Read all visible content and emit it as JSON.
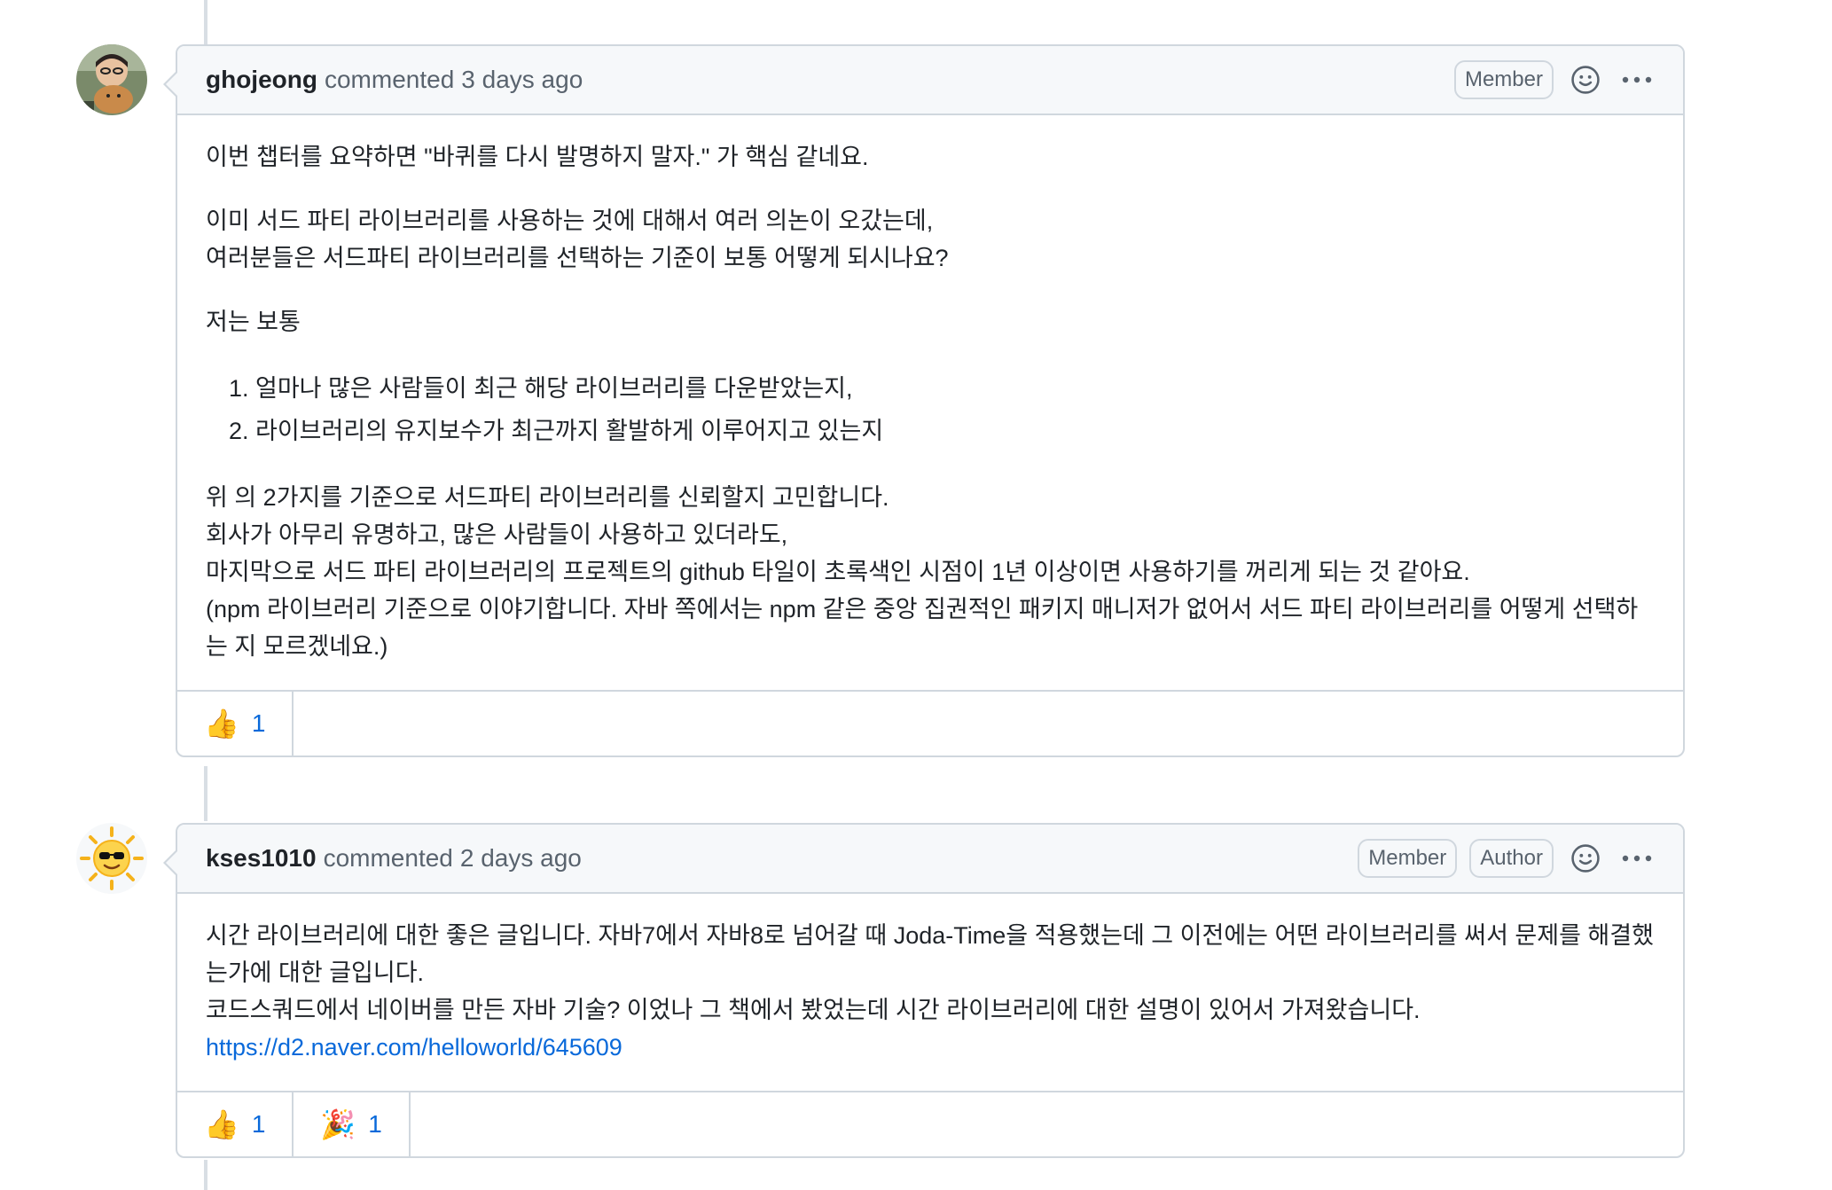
{
  "comments": [
    {
      "author": "ghojeong",
      "commented_text": "commented",
      "timestamp": "3 days ago",
      "badges": [
        "Member"
      ],
      "body": {
        "p1": "이번 챕터를 요약하면 \"바퀴를 다시 발명하지 말자.\" 가 핵심 같네요.",
        "p2_l1": "이미 서드 파티 라이브러리를 사용하는 것에 대해서 여러 의논이 오갔는데,",
        "p2_l2": "여러분들은 서드파티 라이브러리를 선택하는 기준이 보통 어떻게 되시나요?",
        "p3": "저는 보통",
        "list": [
          "얼마나 많은 사람들이 최근 해당 라이브러리를 다운받았는지,",
          "라이브러리의 유지보수가 최근까지 활발하게 이루어지고 있는지"
        ],
        "p4_l1": "위 의 2가지를 기준으로 서드파티 라이브러리를 신뢰할지 고민합니다.",
        "p4_l2": "회사가 아무리 유명하고, 많은 사람들이 사용하고 있더라도,",
        "p4_l3": "마지막으로 서드 파티 라이브러리의 프로젝트의 github 타일이 초록색인 시점이 1년 이상이면 사용하기를 꺼리게 되는 것 같아요.",
        "p4_l4": "(npm 라이브러리 기준으로 이야기합니다. 자바 쪽에서는 npm 같은 중앙 집권적인 패키지 매니저가 없어서 서드 파티 라이브러리를 어떻게 선택하는 지 모르겠네요.)"
      },
      "reactions": [
        {
          "emoji": "👍",
          "count": "1"
        }
      ]
    },
    {
      "author": "kses1010",
      "commented_text": "commented",
      "timestamp": "2 days ago",
      "badges": [
        "Member",
        "Author"
      ],
      "body": {
        "l1": "시간 라이브러리에 대한 좋은 글입니다. 자바7에서 자바8로 넘어갈 때 Joda-Time을 적용했는데 그 이전에는 어떤 라이브러리를 써서 문제를 해결했는가에 대한 글입니다.",
        "l2": "코드스쿼드에서 네이버를 만든 자바 기술? 이었나 그 책에서 봤었는데 시간 라이브러리에 대한 설명이 있어서 가져왔습니다.",
        "link": "https://d2.naver.com/helloworld/645609"
      },
      "reactions": [
        {
          "emoji": "👍",
          "count": "1"
        },
        {
          "emoji": "🎉",
          "count": "1"
        }
      ]
    }
  ],
  "colors": {
    "link": "#0969da",
    "border": "#d0d7de",
    "header_bg": "#f6f8fa",
    "muted": "#59636e"
  },
  "icons": [
    "smiley-icon",
    "kebab-horizontal-icon"
  ]
}
